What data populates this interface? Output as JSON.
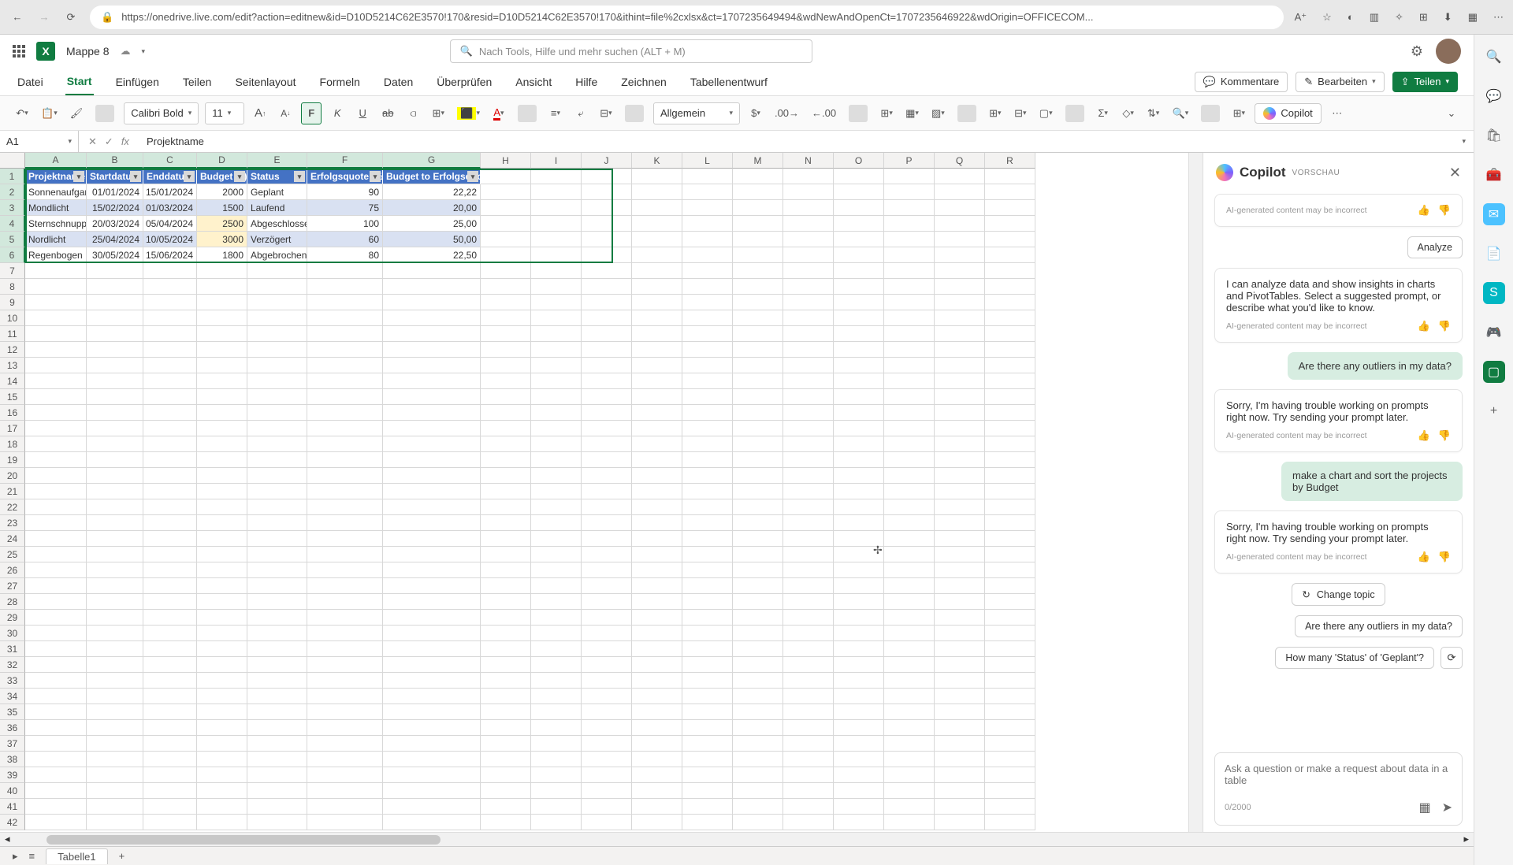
{
  "browser": {
    "url": "https://onedrive.live.com/edit?action=editnew&id=D10D5214C62E3570!170&resid=D10D5214C62E3570!170&ithint=file%2cxlsx&ct=1707235649494&wdNewAndOpenCt=1707235646922&wdOrigin=OFFICECOM..."
  },
  "title": {
    "doc": "Mappe 8",
    "search_ph": "Nach Tools, Hilfe und mehr suchen (ALT + M)"
  },
  "tabs": {
    "list": [
      "Datei",
      "Start",
      "Einfügen",
      "Teilen",
      "Seitenlayout",
      "Formeln",
      "Daten",
      "Überprüfen",
      "Ansicht",
      "Hilfe",
      "Zeichnen",
      "Tabellenentwurf"
    ],
    "active": "Start",
    "kommentare": "Kommentare",
    "bearbeiten": "Bearbeiten",
    "teilen": "Teilen"
  },
  "toolbar": {
    "font": "Calibri Bold",
    "size": "11",
    "numfmt": "Allgemein",
    "copilot": "Copilot"
  },
  "formula": {
    "name": "A1",
    "value": "Projektname"
  },
  "columns": [
    "A",
    "B",
    "C",
    "D",
    "E",
    "F",
    "G",
    "H",
    "I",
    "J",
    "K",
    "L",
    "M",
    "N",
    "O",
    "P",
    "Q",
    "R"
  ],
  "headers": [
    "Projektname",
    "Startdatum",
    "Enddatum",
    "Budget (€)",
    "Status",
    "Erfolgsquote (%)",
    "Budget to Erfolgsquote"
  ],
  "rows": [
    {
      "a": "Sonnenaufgang",
      "b": "01/01/2024",
      "c": "15/01/2024",
      "d": "2000",
      "e": "Geplant",
      "f": "90",
      "g": "22,22"
    },
    {
      "a": "Mondlicht",
      "b": "15/02/2024",
      "c": "01/03/2024",
      "d": "1500",
      "e": "Laufend",
      "f": "75",
      "g": "20,00"
    },
    {
      "a": "Sternschnuppe",
      "b": "20/03/2024",
      "c": "05/04/2024",
      "d": "2500",
      "e": "Abgeschlossen",
      "f": "100",
      "g": "25,00"
    },
    {
      "a": "Nordlicht",
      "b": "25/04/2024",
      "c": "10/05/2024",
      "d": "3000",
      "e": "Verzögert",
      "f": "60",
      "g": "50,00"
    },
    {
      "a": "Regenbogen",
      "b": "30/05/2024",
      "c": "15/06/2024",
      "d": "1800",
      "e": "Abgebrochen",
      "f": "80",
      "g": "22,50"
    }
  ],
  "copilot": {
    "title": "Copilot",
    "badge": "VORSCHAU",
    "analyze": "Analyze",
    "body1": "I can analyze data and show insights in charts and PivotTables. Select a suggested prompt, or describe what you'd like to know.",
    "disclaimer": "AI-generated content may be incorrect",
    "user1": "Are there any outliers in my data?",
    "err": "Sorry, I'm having trouble working on prompts right now. Try sending your prompt later.",
    "user2": "make a chart and sort the projects by Budget",
    "change": "Change topic",
    "sugg1": "Are there any outliers in my data?",
    "sugg2": "How many 'Status' of 'Geplant'?",
    "input_ph": "Ask a question or make a request about data in a table",
    "counter": "0/2000"
  },
  "status": {
    "sheet": "Tabelle1"
  }
}
